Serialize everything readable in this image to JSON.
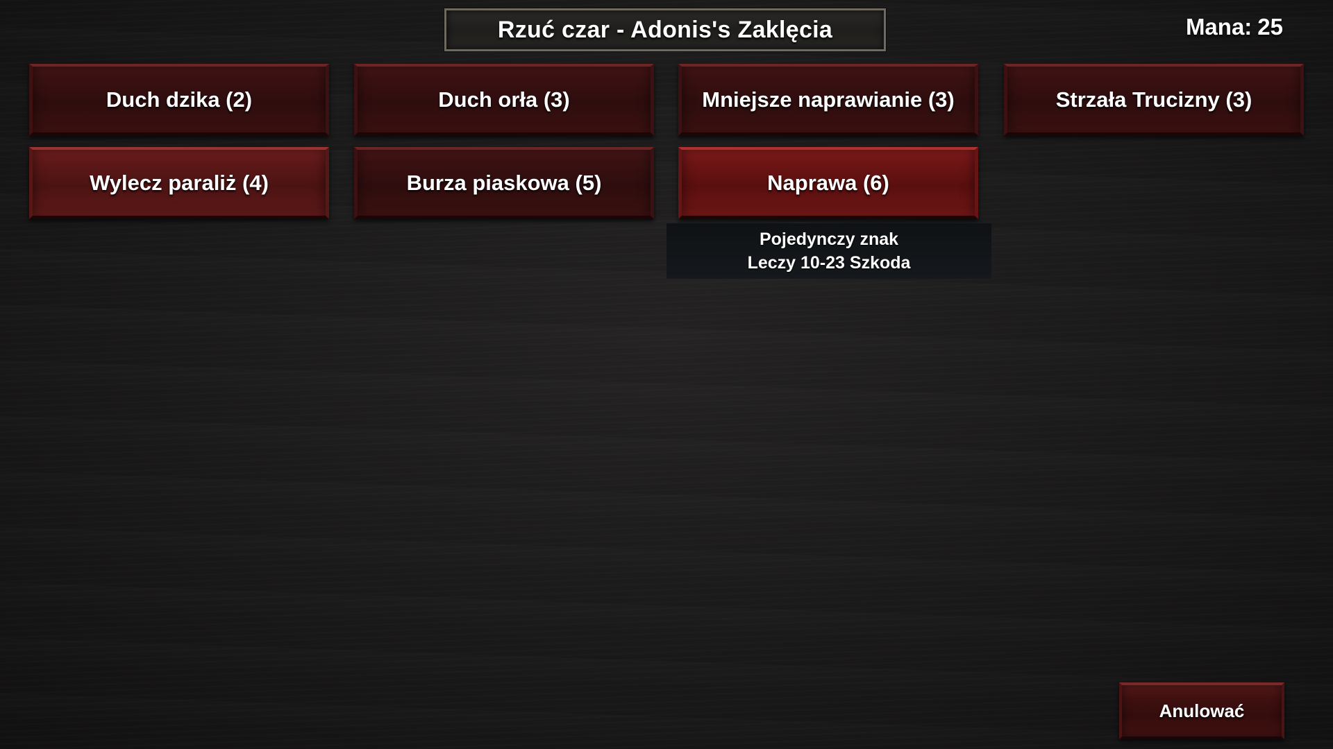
{
  "header": {
    "title": "Rzuć czar - Adonis's Zaklęcia",
    "mana_label": "Mana:",
    "mana_value": "25"
  },
  "spells": [
    {
      "label": "Duch dzika (2)"
    },
    {
      "label": "Duch orła (3)"
    },
    {
      "label": "Mniejsze naprawianie (3)"
    },
    {
      "label": "Strzała Trucizny (3)"
    },
    {
      "label": "Wylecz paraliż (4)"
    },
    {
      "label": "Burza piaskowa (5)"
    },
    {
      "label": "Naprawa (6)"
    }
  ],
  "tooltip": {
    "line1": "Pojedynczy znak",
    "line2": "Leczy 10-23 Szkoda"
  },
  "footer": {
    "cancel_label": "Anulować"
  },
  "colors": {
    "button_red": "#3a1112",
    "button_highlight": "#6e1515",
    "tooltip_bg": "#12151a"
  }
}
